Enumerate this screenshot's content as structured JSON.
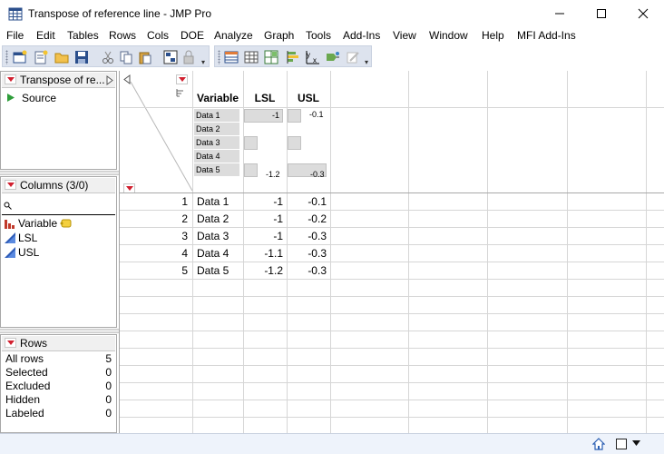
{
  "window": {
    "title": "Transpose of reference line - JMP Pro"
  },
  "menu": [
    "File",
    "Edit",
    "Tables",
    "Rows",
    "Cols",
    "DOE",
    "Analyze",
    "Graph",
    "Tools",
    "Add-Ins",
    "View",
    "Window",
    "Help",
    "MFI Add-Ins"
  ],
  "table_pane": {
    "title": "Transpose of re...",
    "items": [
      "Source"
    ]
  },
  "columns_pane": {
    "title": "Columns (3/0)",
    "search_placeholder": "",
    "items": [
      {
        "name": "Variable",
        "icon": "nominal-bar-icon"
      },
      {
        "name": "LSL",
        "icon": "continuous-triangle-icon"
      },
      {
        "name": "USL",
        "icon": "continuous-triangle-icon"
      }
    ]
  },
  "rows_pane": {
    "title": "Rows",
    "stats": [
      {
        "label": "All rows",
        "value": "5"
      },
      {
        "label": "Selected",
        "value": "0"
      },
      {
        "label": "Excluded",
        "value": "0"
      },
      {
        "label": "Hidden",
        "value": "0"
      },
      {
        "label": "Labeled",
        "value": "0"
      }
    ]
  },
  "grid": {
    "columns": [
      "Variable",
      "LSL",
      "USL"
    ],
    "summary": {
      "variable_levels": [
        "Data 1",
        "Data 2",
        "Data 3",
        "Data 4",
        "Data 5"
      ],
      "lsl_max": "-1",
      "lsl_min": "-1.2",
      "usl_max": "-0.1",
      "usl_min": "-0.3"
    },
    "rows": [
      {
        "n": "1",
        "variable": "Data 1",
        "lsl": "-1",
        "usl": "-0.1"
      },
      {
        "n": "2",
        "variable": "Data 2",
        "lsl": "-1",
        "usl": "-0.2"
      },
      {
        "n": "3",
        "variable": "Data 3",
        "lsl": "-1",
        "usl": "-0.3"
      },
      {
        "n": "4",
        "variable": "Data 4",
        "lsl": "-1.1",
        "usl": "-0.3"
      },
      {
        "n": "5",
        "variable": "Data 5",
        "lsl": "-1.2",
        "usl": "-0.3"
      }
    ]
  },
  "colors": {
    "red_triangle": "#d1202f",
    "toolbar_bg": "#dde3ee",
    "status_bg": "#eef3fb"
  }
}
